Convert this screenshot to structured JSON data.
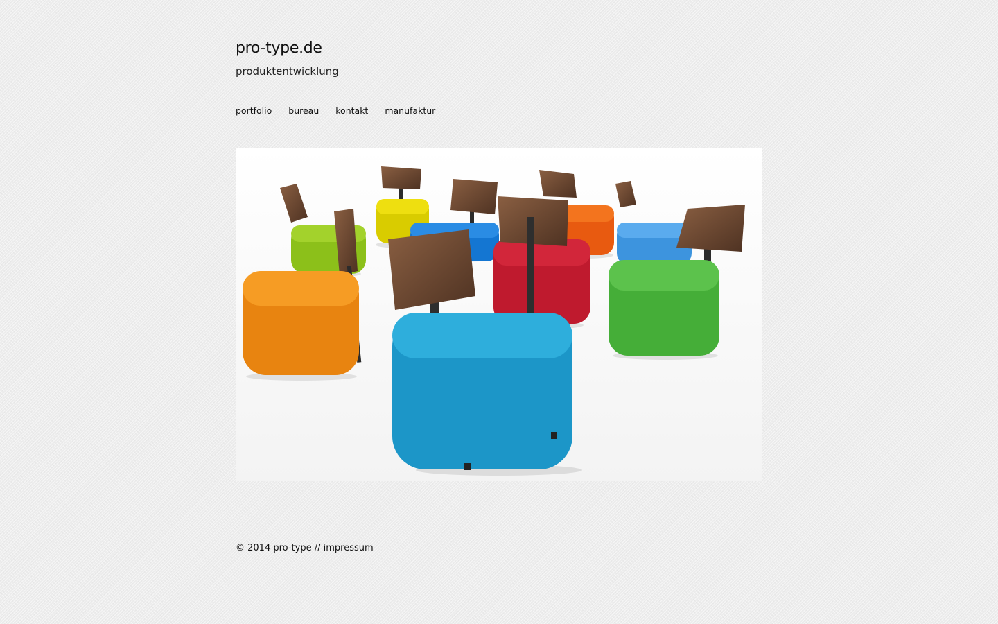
{
  "header": {
    "title": "pro-type.de",
    "tagline": "produktentwicklung"
  },
  "nav": {
    "items": [
      {
        "label": "portfolio"
      },
      {
        "label": "bureau"
      },
      {
        "label": "kontakt"
      },
      {
        "label": "manufaktur"
      }
    ]
  },
  "hero": {
    "image": "product-photo-colorful-upholstered-chairs-with-wooden-backrests",
    "background": "#ffffff",
    "chair_colors": [
      "#f0dc00",
      "#1e7fd8",
      "#f06414",
      "#3aa0e8",
      "#9ad014",
      "#f08c14",
      "#c81e32",
      "#4cb43c",
      "#1e9ed0"
    ],
    "wood_color": "#6b4630"
  },
  "footer": {
    "copyright": "© 2014 pro-type //",
    "impressum": "impressum"
  },
  "colors": {
    "page_background": "#ececec",
    "text": "#111111"
  }
}
